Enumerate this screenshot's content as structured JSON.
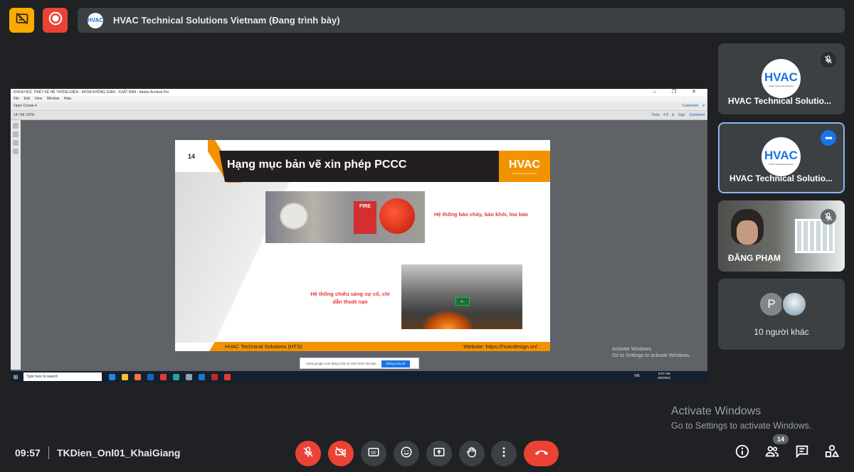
{
  "presenter": {
    "logo_text": "HVAC",
    "title": "HVAC Technical Solutions Vietnam (Đang trình bày)"
  },
  "acrobat": {
    "window_title": "KHOA HỌC THIẾT KẾ HỆ THỐNG ĐIỆN - KHÓA KHÔNG GIAN - XUẤT BẢN - Adobe Acrobat Pro",
    "menu": "File Edit View Window Help",
    "toolbar1": "Open   Create ▾",
    "toolbar2": "14 / 69    125%",
    "right_tools": "Tools   Fill & Sign   Comment",
    "win_controls": "– ❐ ✕",
    "customize": "Customize ▾"
  },
  "slide": {
    "number": "14",
    "title": "Hạng mục bản vẽ xin phép PCCC",
    "logo": "HVAC",
    "logo_sub": "HVAC Technical Solutions",
    "fire_label": "FIRE",
    "caption1": "Hệ thống báo cháy, báo khói, loa báo",
    "caption2": "Hệ thống chiếu sáng sự cố, chỉ dẫn thoát nạn",
    "footer_left": "HVAC Technical Solutions (HTS)",
    "footer_right": "Website: https://hvacdesign.vn/"
  },
  "screen_watermark": {
    "line1": "Activate Windows",
    "line2": "Go to Settings to activate Windows."
  },
  "screen_notify": {
    "text": "meet.google.com đang chia sẻ màn hình của bạn.",
    "button": "Dừng chia sẻ"
  },
  "taskbar": {
    "search": "Type here to search",
    "time": "9:57 AM",
    "date": "6/6/2022",
    "lang": "VIE"
  },
  "participants": [
    {
      "name": "HVAC Technical Solutio...",
      "avatar": "HVAC",
      "avatar_sub": "HVAC Technical Solutions",
      "muted": true
    },
    {
      "name": "HVAC Technical Solutio...",
      "avatar": "HVAC",
      "avatar_sub": "HVAC Technical Solutions",
      "more": "•••"
    },
    {
      "name": "ĐĂNG PHẠM",
      "muted": true
    },
    {
      "initial": "P",
      "label": "10 người khác"
    }
  ],
  "activate": {
    "line1": "Activate Windows",
    "line2": "Go to Settings to activate Windows."
  },
  "bottom": {
    "time": "09:57",
    "meeting_code": "TKDien_Onl01_KhaiGiang",
    "people_count": "14"
  },
  "colors": {
    "accent_orange": "#f39200",
    "danger": "#ea4335",
    "blue": "#1a73e8"
  },
  "icons": [
    "captions-off-icon",
    "record-icon",
    "mic-off-icon",
    "camera-off-icon",
    "closed-caption-icon",
    "emoji-icon",
    "present-icon",
    "raise-hand-icon",
    "more-vert-icon",
    "hangup-icon",
    "info-icon",
    "people-icon",
    "chat-icon",
    "activities-icon"
  ]
}
